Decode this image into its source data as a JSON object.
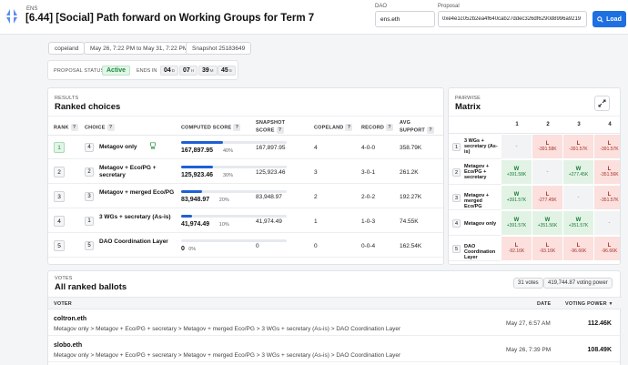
{
  "header": {
    "ens_label": "ENS",
    "title": "[6.44] [Social] Path forward on Working Groups for Term 7",
    "dao_label": "DAO",
    "dao_value": "ens.eth",
    "proposal_label": "Proposal",
    "proposal_value": "0xe4e1c052b2ea4f640cab27ddec326df6290d8996a9219",
    "load_label": "Load"
  },
  "meta": {
    "method": "copeland",
    "dates": "May 26, 7:22 PM to May 31, 7:22 PM",
    "snapshot": "Snapshot 25183649"
  },
  "status": {
    "label": "PROPOSAL STATUS",
    "value": "Active",
    "ends_label": "ENDS IN",
    "days": "04",
    "days_unit": "D",
    "hours": "07",
    "hours_unit": "H",
    "mins": "39",
    "mins_unit": "M",
    "secs": "45",
    "secs_unit": "S"
  },
  "results": {
    "section_label": "RESULTS",
    "title": "Ranked choices",
    "columns": {
      "rank": "RANK",
      "choice": "CHOICE",
      "computed": "COMPUTED SCORE",
      "snapshot1": "SNAPSHOT",
      "snapshot2": "SCORE",
      "copeland": "COPELAND",
      "record": "RECORD",
      "avg1": "AVG",
      "avg2": "SUPPORT"
    },
    "rows": [
      {
        "rank": "1",
        "num": "4",
        "name": "Metagov only",
        "score": "167,897.95",
        "pct": "40%",
        "fraction": 0.4,
        "snapshot": "167,897.95",
        "copeland": "4",
        "record": "4-0-0",
        "avg": "358.79K"
      },
      {
        "rank": "2",
        "num": "2",
        "name": "Metagov + Eco/PG + secretary",
        "score": "125,923.46",
        "pct": "30%",
        "fraction": 0.3,
        "snapshot": "125,923.46",
        "copeland": "3",
        "record": "3-0-1",
        "avg": "261.2K"
      },
      {
        "rank": "3",
        "num": "3",
        "name": "Metagov + merged Eco/PG",
        "score": "83,948.97",
        "pct": "20%",
        "fraction": 0.2,
        "snapshot": "83,948.97",
        "copeland": "2",
        "record": "2-0-2",
        "avg": "192.27K"
      },
      {
        "rank": "4",
        "num": "1",
        "name": "3 WGs + secretary (As-is)",
        "score": "41,974.49",
        "pct": "10%",
        "fraction": 0.1,
        "snapshot": "41,974.49",
        "copeland": "1",
        "record": "1-0-3",
        "avg": "74.55K"
      },
      {
        "rank": "5",
        "num": "5",
        "name": "DAO Coordination Layer",
        "score": "0",
        "pct": "0%",
        "fraction": 0.0,
        "snapshot": "0",
        "copeland": "0",
        "record": "0-0-4",
        "avg": "162.54K"
      }
    ]
  },
  "matrix": {
    "section_label": "PAIRWISE",
    "title": "Matrix",
    "columns": [
      "1",
      "2",
      "3",
      "4"
    ],
    "rows": [
      {
        "num": "1",
        "name": "3 WGs + secretary (As-is)",
        "cells": [
          {
            "type": "d",
            "r": "-",
            "v": ""
          },
          {
            "type": "l",
            "r": "L",
            "v": "-391.58K"
          },
          {
            "type": "l",
            "r": "L",
            "v": "-391.57K"
          },
          {
            "type": "l",
            "r": "L",
            "v": "-391.57K"
          }
        ]
      },
      {
        "num": "2",
        "name": "Metagov + Eco/PG + secretary",
        "cells": [
          {
            "type": "w",
            "r": "W",
            "v": "+391.58K"
          },
          {
            "type": "d",
            "r": "-",
            "v": ""
          },
          {
            "type": "w",
            "r": "W",
            "v": "+277.45K"
          },
          {
            "type": "l",
            "r": "L",
            "v": "-351.56K"
          }
        ]
      },
      {
        "num": "3",
        "name": "Metagov + merged Eco/PG",
        "cells": [
          {
            "type": "w",
            "r": "W",
            "v": "+391.57K"
          },
          {
            "type": "l",
            "r": "L",
            "v": "-277.45K"
          },
          {
            "type": "d",
            "r": "-",
            "v": ""
          },
          {
            "type": "l",
            "r": "L",
            "v": "-351.57K"
          }
        ]
      },
      {
        "num": "4",
        "name": "Metagov only",
        "cells": [
          {
            "type": "w",
            "r": "W",
            "v": "+391.57K"
          },
          {
            "type": "w",
            "r": "W",
            "v": "+351.56K"
          },
          {
            "type": "w",
            "r": "W",
            "v": "+351.57K"
          },
          {
            "type": "d",
            "r": "-",
            "v": ""
          }
        ]
      },
      {
        "num": "5",
        "name": "DAO Coordination Layer",
        "cells": [
          {
            "type": "l",
            "r": "L",
            "v": "-92.16K"
          },
          {
            "type": "l",
            "r": "L",
            "v": "-93.16K"
          },
          {
            "type": "l",
            "r": "L",
            "v": "-96.66K"
          },
          {
            "type": "l",
            "r": "L",
            "v": "-96.66K"
          }
        ]
      }
    ]
  },
  "votes": {
    "section_label": "VOTES",
    "title": "All ranked ballots",
    "count_chip": "31 votes",
    "power_chip": "419,744.87 voting power",
    "col_voter": "VOTER",
    "col_date": "DATE",
    "col_power": "VOTING POWER",
    "rows": [
      {
        "voter": "coltron.eth",
        "ballot": "Metagov only > Metagov + Eco/PG + secretary > Metagov + merged Eco/PG > 3 WGs + secretary (As-is) > DAO Coordination Layer",
        "date": "May 27, 6:57 AM",
        "power": "112.46K"
      },
      {
        "voter": "slobo.eth",
        "ballot": "Metagov only > Metagov + Eco/PG + secretary > Metagov + merged Eco/PG > 3 WGs + secretary (As-is) > DAO Coordination Layer",
        "date": "May 26, 7:39 PM",
        "power": "108.49K"
      }
    ]
  }
}
